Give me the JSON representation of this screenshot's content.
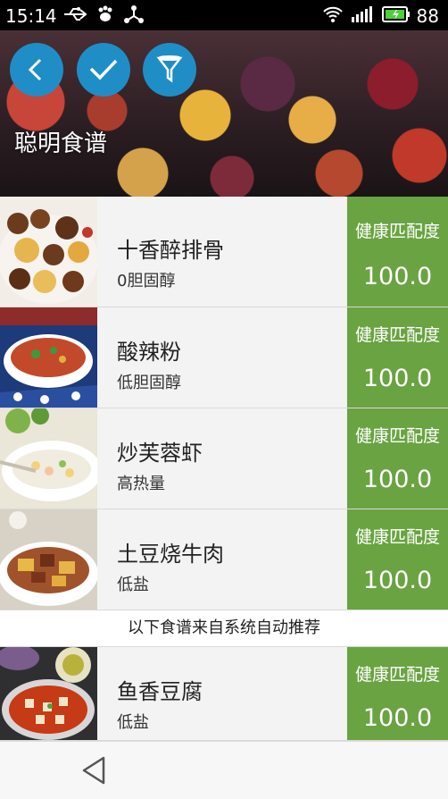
{
  "status_bar": {
    "time": "15:14",
    "battery_level": "88",
    "icons": [
      "usb-icon",
      "paw-icon",
      "share-icon",
      "wifi-icon",
      "signal-icon",
      "battery-icon"
    ]
  },
  "header": {
    "title": "聪明食谱",
    "buttons": [
      "back-icon",
      "check-icon",
      "filter-icon"
    ],
    "accent_color": "#1f8ec6"
  },
  "recipes": [
    {
      "name": "十香醉排骨",
      "tag": "0胆固醇",
      "score_label": "健康匹配度",
      "score": "100.0",
      "thumb": "braised-ribs"
    },
    {
      "name": "酸辣粉",
      "tag": "低胆固醇",
      "score_label": "健康匹配度",
      "score": "100.0",
      "thumb": "hot-sour-noodles"
    },
    {
      "name": "炒芙蓉虾",
      "tag": "高热量",
      "score_label": "健康匹配度",
      "score": "100.0",
      "thumb": "shrimp-egg"
    },
    {
      "name": "土豆烧牛肉",
      "tag": "低盐",
      "score_label": "健康匹配度",
      "score": "100.0",
      "thumb": "beef-potato"
    }
  ],
  "recommend_section": {
    "label": "以下食谱来自系统自动推荐"
  },
  "recommended": [
    {
      "name": "鱼香豆腐",
      "tag": "低盐",
      "score_label": "健康匹配度",
      "score": "100.0",
      "thumb": "mapo-tofu"
    }
  ],
  "score_color": "#6aa342",
  "nav_bar": {
    "buttons": [
      "nav-back-icon"
    ]
  }
}
